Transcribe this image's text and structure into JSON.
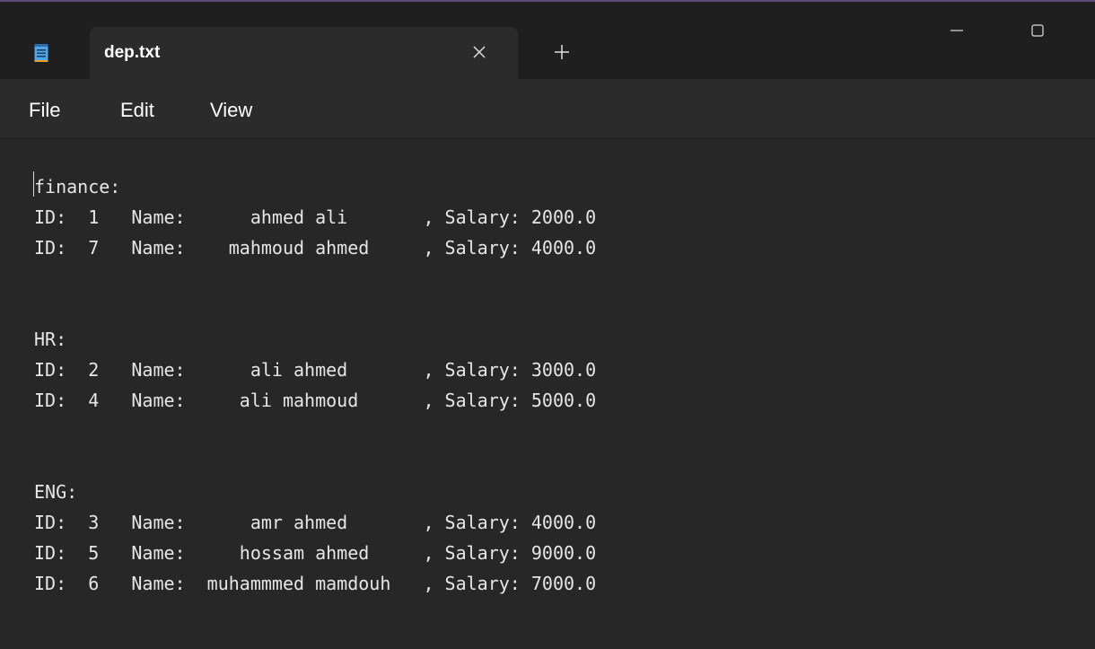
{
  "tab": {
    "title": "dep.txt"
  },
  "menu": {
    "items": [
      "File",
      "Edit",
      "View"
    ]
  },
  "editor": {
    "lines": [
      "finance:",
      "ID:  1   Name:      ahmed ali       , Salary: 2000.0",
      "ID:  7   Name:    mahmoud ahmed     , Salary: 4000.0",
      "",
      "",
      "HR:",
      "ID:  2   Name:      ali ahmed       , Salary: 3000.0",
      "ID:  4   Name:     ali mahmoud      , Salary: 5000.0",
      "",
      "",
      "ENG:",
      "ID:  3   Name:      amr ahmed       , Salary: 4000.0",
      "ID:  5   Name:     hossam ahmed     , Salary: 9000.0",
      "ID:  6   Name:  muhammmed mamdouh   , Salary: 7000.0"
    ]
  },
  "icons": {
    "app": "notepad-icon",
    "close_tab": "close-icon",
    "new_tab": "plus-icon",
    "minimize": "minimize-icon",
    "maximize": "maximize-icon"
  },
  "colors": {
    "titlebar_bg": "#1f1f1f",
    "tab_bg": "#2b2b2b",
    "editor_bg": "#272727",
    "text": "#e6e6e6",
    "icon_accent": "#5fa8e6"
  }
}
